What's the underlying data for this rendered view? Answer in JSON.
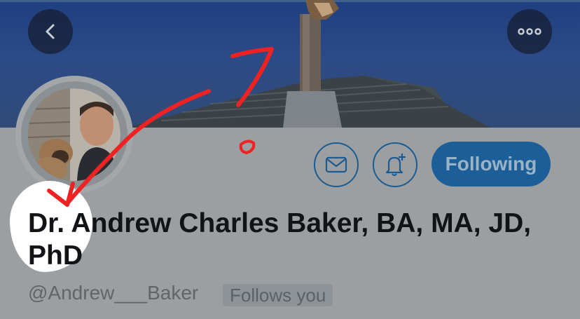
{
  "header": {
    "back_icon": "chevron-left-icon",
    "more_icon": "ellipsis-icon"
  },
  "profile": {
    "display_name": "Dr. Andrew Charles Baker, BA, MA, JD, PhD",
    "handle": "@Andrew___Baker",
    "follows_you_label": "Follows you",
    "following_label": "Following",
    "message_icon": "envelope-icon",
    "notify_icon": "bell-plus-icon"
  },
  "annotation": {
    "number_text": "7",
    "color": "#ee2222"
  },
  "colors": {
    "accent": "#1c5f98",
    "banner": "#2c4a86",
    "overlay_gray": "#9c9fa2"
  }
}
